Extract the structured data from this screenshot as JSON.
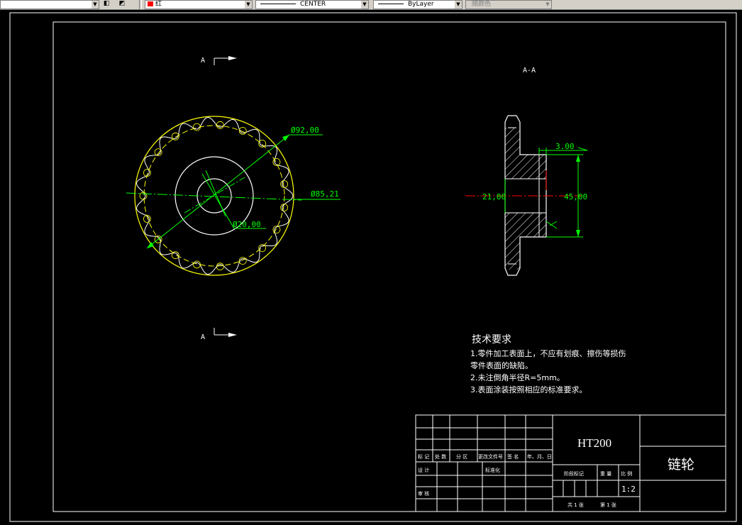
{
  "toolbar": {
    "color_value": "红",
    "linetype_value": "CENTER",
    "lineweight_value": "ByLayer",
    "plotstyle_value": "随颜色"
  },
  "drawing": {
    "section_mark_top": "A",
    "section_mark_bottom": "A",
    "section_title": "A-A",
    "dim_outer_diameter": "Ø92,00",
    "dim_pitch_diameter": "Ø85,21",
    "dim_bore_diameter": "Ø20,00",
    "dim_hub_width": "3.00",
    "dim_bore_side": "21,00",
    "dim_hub_diameter": "45,00",
    "tech_title": "技术要求",
    "tech_lines": [
      "1.零件加工表面上，不应有划痕、擦伤等损伤",
      "零件表面的缺陷。",
      "2.未注倒角半径R=5mm。",
      "3.表面涂装按照相应的标准要求。"
    ]
  },
  "title_block": {
    "material": "HT200",
    "part_name": "链轮",
    "scale": "1:2",
    "label_mark": "标 记",
    "label_count": "处 数",
    "label_zone": "分 区",
    "label_change_doc": "更改文件号",
    "label_sign": "签 名",
    "label_date": "年、月、日",
    "label_design": "设 计",
    "label_standard": "标准化",
    "label_audit": "审 核",
    "label_stage": "阶段标记",
    "label_weight": "重 量",
    "label_ratio": "比 例",
    "label_total": "共 1 张",
    "label_sheet": "第 1 张"
  },
  "colors": {
    "background": "#000000",
    "outline": "#ffffff",
    "dimension": "#00ff00",
    "centerline": "#ff0000",
    "chain_profile": "#ffff00"
  }
}
